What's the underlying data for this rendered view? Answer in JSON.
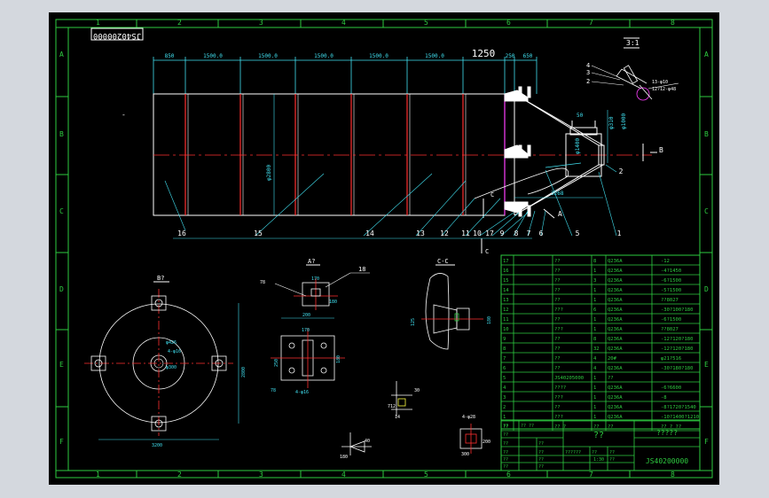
{
  "colors": {
    "frame": "#2ecc40",
    "structure": "#ffffff",
    "dimension": "#40e0f0",
    "section": "#ff3030",
    "magenta": "#ff40ff",
    "accent": "#ffff40",
    "background": "#000000",
    "outer": "#d4d8de"
  },
  "drawing_number": "JS40200000",
  "top_columns": [
    "1",
    "2",
    "3",
    "4",
    "5",
    "6",
    "7",
    "8"
  ],
  "bottom_columns": [
    "1",
    "2",
    "3",
    "4",
    "5",
    "6",
    "7",
    "8"
  ],
  "left_rows": [
    "A",
    "B",
    "C",
    "D",
    "E",
    "F"
  ],
  "right_rows": [
    "A",
    "B",
    "C",
    "D",
    "E",
    "F"
  ],
  "main_view": {
    "dimensions": [
      "850",
      "1500.0",
      "1500.0",
      "1500.0",
      "1500.0",
      "1500.0",
      "1250",
      "250",
      "650"
    ],
    "diameter_label": "φ2800",
    "detail_dims": [
      "50",
      "φ310",
      "φ1000",
      "φ1400",
      "3268"
    ],
    "callouts": [
      "16",
      "15",
      "14",
      "13",
      "12",
      "11",
      "10",
      "17",
      "9",
      "8",
      "7",
      "6",
      "5",
      "1",
      "2"
    ],
    "section_marks": [
      "C",
      "C",
      "A",
      "B"
    ],
    "cross_mark": "-"
  },
  "detail_view": {
    "label": "3:1",
    "callouts": [
      "4",
      "3",
      "2"
    ],
    "notes": [
      "13-φ10",
      "12?12-φ48"
    ]
  },
  "plan_view": {
    "label": "B?",
    "dims": [
      "φ426",
      "4-φ16",
      "φ300",
      "2800",
      "3200"
    ]
  },
  "view_a": {
    "label": "A?",
    "callouts": [
      "18",
      "78"
    ],
    "dims": [
      "170",
      "180",
      "200",
      "170",
      "250",
      "180",
      "4-φ16",
      "78"
    ]
  },
  "section_c": {
    "label": "C-C",
    "dims": [
      "125",
      "180"
    ]
  },
  "small_details": {
    "d1": [
      "30",
      "712",
      "14"
    ],
    "d2": [
      "4-φ28",
      "200",
      "300"
    ],
    "d3": [
      "40",
      "180"
    ]
  },
  "parts_table": {
    "rows": [
      {
        "no": "17",
        "name": "??",
        "qty": "8",
        "mat": "Q236A",
        "spec": "-12"
      },
      {
        "no": "16",
        "name": "??",
        "qty": "1",
        "mat": "Q236A",
        "spec": "-4?1450"
      },
      {
        "no": "15",
        "name": "??",
        "qty": "3",
        "mat": "Q236A",
        "spec": "-6?1500"
      },
      {
        "no": "14",
        "name": "??",
        "qty": "1",
        "mat": "Q236A",
        "spec": "-5?1500"
      },
      {
        "no": "13",
        "name": "??",
        "qty": "1",
        "mat": "Q236A",
        "spec": "??8027"
      },
      {
        "no": "12",
        "name": "???",
        "qty": "6",
        "mat": "Q236A",
        "spec": "-30?100?180"
      },
      {
        "no": "11",
        "name": "??",
        "qty": "1",
        "mat": "Q236A",
        "spec": "-6?1500"
      },
      {
        "no": "10",
        "name": "???",
        "qty": "1",
        "mat": "Q236A",
        "spec": "??8027"
      },
      {
        "no": "9",
        "name": "??",
        "qty": "8",
        "mat": "Q236A",
        "spec": "-12?120?180"
      },
      {
        "no": "8",
        "name": "??",
        "qty": "32",
        "mat": "Q236A",
        "spec": "-12?120?180"
      },
      {
        "no": "7",
        "name": "??",
        "qty": "4",
        "mat": "20#",
        "spec": "φ21?516"
      },
      {
        "no": "6",
        "name": "??",
        "qty": "4",
        "mat": "Q236A",
        "spec": "-30?180?180"
      },
      {
        "no": "5",
        "name": "JS40205000",
        "qty": "1",
        "mat": "??",
        "spec": ""
      },
      {
        "no": "4",
        "name": "????",
        "qty": "1",
        "mat": "Q236A",
        "spec": "-6?6600"
      },
      {
        "no": "3",
        "name": "???",
        "qty": "1",
        "mat": "Q236A",
        "spec": "-8"
      },
      {
        "no": "2",
        "name": "??",
        "qty": "1",
        "mat": "Q236A",
        "spec": "-8?1720?1540"
      },
      {
        "no": "1",
        "name": "???",
        "qty": "1",
        "mat": "Q236A",
        "spec": "-10?1400?1210"
      }
    ],
    "header": {
      "no": "??",
      "name": "?? ?",
      "qty": "??",
      "mat": "??",
      "spec": "?? ? ??"
    }
  },
  "title_block": {
    "title": "??",
    "subtitle": "?????",
    "drawing_no": "JS40200000",
    "scale_label": "??",
    "scale": "1:30",
    "stage_label": "??????",
    "labels": [
      "??",
      "??",
      "??",
      "??",
      "??",
      "?? ??",
      "??",
      "??",
      "??",
      "??",
      "??",
      "??",
      "??"
    ]
  }
}
